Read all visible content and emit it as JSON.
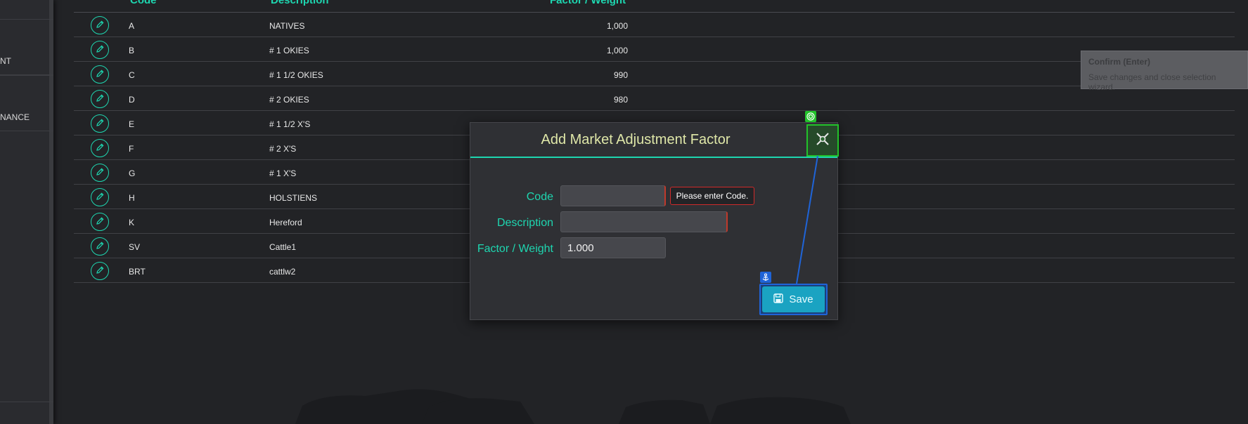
{
  "sidebar": {
    "items": [
      "NT",
      "NANCE"
    ]
  },
  "grid": {
    "headers": {
      "code": "Code",
      "description": "Description",
      "factor": "Factor / Weight"
    },
    "rows": [
      {
        "code": "A",
        "description": "NATIVES",
        "factor": "1,000"
      },
      {
        "code": "B",
        "description": "# 1 OKIES",
        "factor": "1,000"
      },
      {
        "code": "C",
        "description": "# 1 1/2 OKIES",
        "factor": "990"
      },
      {
        "code": "D",
        "description": "# 2 OKIES",
        "factor": "980"
      },
      {
        "code": "E",
        "description": "# 1 1/2  X'S",
        "factor": ""
      },
      {
        "code": "F",
        "description": "# 2  X'S",
        "factor": ""
      },
      {
        "code": "G",
        "description": "# 1 X'S",
        "factor": ""
      },
      {
        "code": "H",
        "description": "HOLSTIENS",
        "factor": ""
      },
      {
        "code": "K",
        "description": "Hereford",
        "factor": ""
      },
      {
        "code": "SV",
        "description": "Cattle1",
        "factor": ""
      },
      {
        "code": "BRT",
        "description": "cattlw2",
        "factor": ""
      }
    ]
  },
  "tooltip": {
    "title": "Confirm (Enter)",
    "text": "Save changes and close selection wizard."
  },
  "modal": {
    "title": "Add Market Adjustment Factor",
    "code_label": "Code",
    "code_value": "",
    "code_error": "Please enter Code.",
    "description_label": "Description",
    "description_value": "",
    "factor_label": "Factor / Weight",
    "factor_value": "1.000",
    "save_label": "Save"
  },
  "colors": {
    "accent": "#1ed6b0",
    "background": "#222326",
    "save": "#1aa3c2",
    "confirm_badge": "#22c22a",
    "anchor_badge": "#1f64d8",
    "error": "#d02a2a"
  },
  "icons": {
    "row_edit": "pencil-icon",
    "close": "close-x-icon",
    "save": "floppy-disk-icon",
    "confirm_badge": "target-icon",
    "anchor_badge": "anchor-icon"
  }
}
